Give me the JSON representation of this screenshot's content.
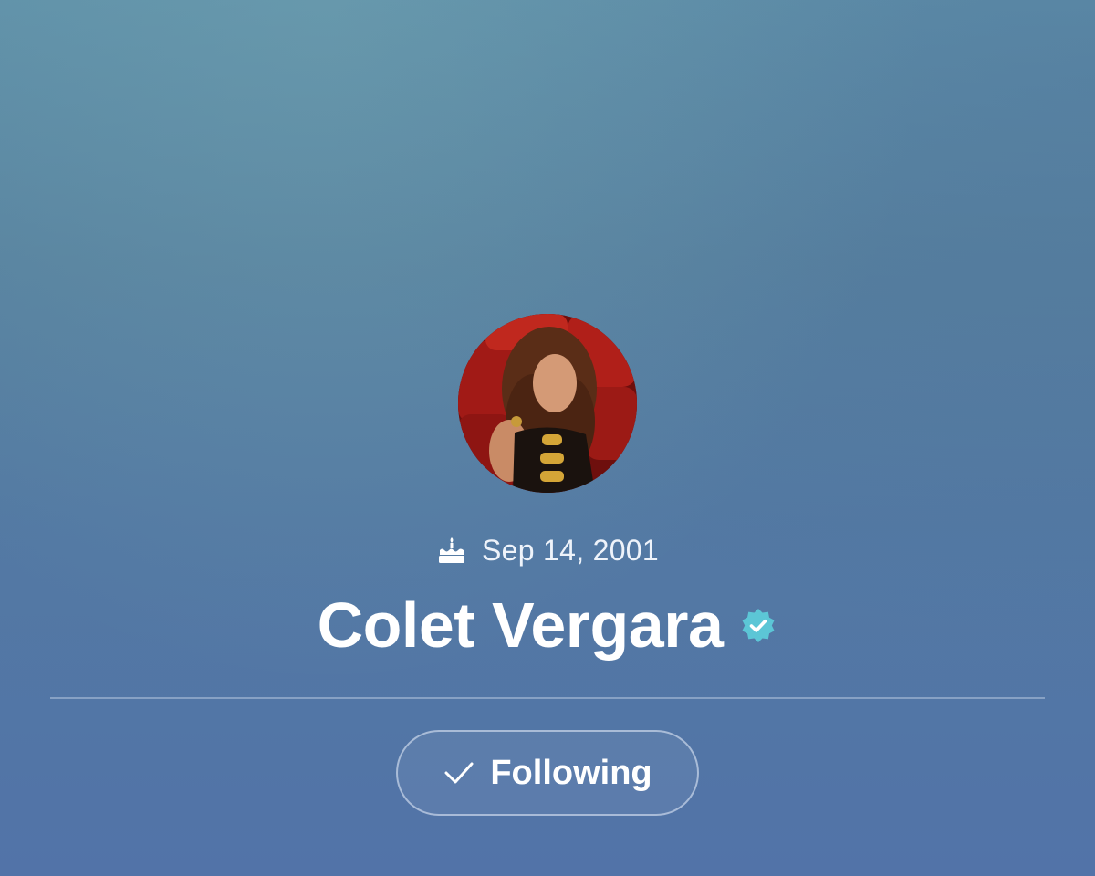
{
  "profile": {
    "birthday": "Sep 14, 2001",
    "name": "Colet Vergara",
    "verified": true
  },
  "actions": {
    "follow_label": "Following"
  },
  "icons": {
    "birthday": "cake-icon",
    "verified": "verified-badge-icon",
    "follow": "checkmark-icon"
  },
  "colors": {
    "verified_badge": "#5cc6d6",
    "text": "#ffffff"
  }
}
